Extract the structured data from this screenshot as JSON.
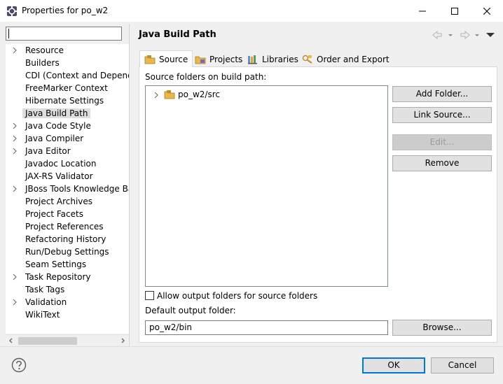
{
  "window": {
    "title": "Properties for po_w2",
    "icons": {
      "app": "eclipse-properties-icon",
      "minimize": "minimize-icon",
      "maximize": "maximize-icon",
      "close": "close-icon"
    }
  },
  "filter": {
    "value": "",
    "placeholder": ""
  },
  "tree": {
    "items": [
      {
        "label": "Resource",
        "expandable": true,
        "selected": false
      },
      {
        "label": "Builders",
        "expandable": false,
        "selected": false
      },
      {
        "label": "CDI (Context and Dependen",
        "expandable": false,
        "selected": false
      },
      {
        "label": "FreeMarker Context",
        "expandable": false,
        "selected": false
      },
      {
        "label": "Hibernate Settings",
        "expandable": false,
        "selected": false
      },
      {
        "label": "Java Build Path",
        "expandable": false,
        "selected": true
      },
      {
        "label": "Java Code Style",
        "expandable": true,
        "selected": false
      },
      {
        "label": "Java Compiler",
        "expandable": true,
        "selected": false
      },
      {
        "label": "Java Editor",
        "expandable": true,
        "selected": false
      },
      {
        "label": "Javadoc Location",
        "expandable": false,
        "selected": false
      },
      {
        "label": "JAX-RS Validator",
        "expandable": false,
        "selected": false
      },
      {
        "label": "JBoss Tools Knowledge Bas",
        "expandable": true,
        "selected": false
      },
      {
        "label": "Project Archives",
        "expandable": false,
        "selected": false
      },
      {
        "label": "Project Facets",
        "expandable": false,
        "selected": false
      },
      {
        "label": "Project References",
        "expandable": false,
        "selected": false
      },
      {
        "label": "Refactoring History",
        "expandable": false,
        "selected": false
      },
      {
        "label": "Run/Debug Settings",
        "expandable": false,
        "selected": false
      },
      {
        "label": "Seam Settings",
        "expandable": false,
        "selected": false
      },
      {
        "label": "Task Repository",
        "expandable": true,
        "selected": false
      },
      {
        "label": "Task Tags",
        "expandable": false,
        "selected": false
      },
      {
        "label": "Validation",
        "expandable": true,
        "selected": false
      },
      {
        "label": "WikiText",
        "expandable": false,
        "selected": false
      }
    ]
  },
  "page": {
    "title": "Java Build Path",
    "nav_icons": [
      "back-arrow-icon",
      "back-menu-icon",
      "forward-arrow-icon",
      "forward-menu-icon",
      "view-menu-icon"
    ]
  },
  "tabs": [
    {
      "label": "Source",
      "icon": "source-folder-icon",
      "active": true
    },
    {
      "label": "Projects",
      "icon": "projects-icon",
      "active": false
    },
    {
      "label": "Libraries",
      "icon": "libraries-icon",
      "active": false
    },
    {
      "label": "Order and Export",
      "icon": "order-export-icon",
      "active": false
    }
  ],
  "source": {
    "heading": "Source folders on build path:",
    "folders": [
      {
        "label": "po_w2/src",
        "icon": "package-folder-icon"
      }
    ],
    "buttons": {
      "add_folder": "Add Folder...",
      "link_source": "Link Source...",
      "edit": "Edit...",
      "remove": "Remove"
    },
    "allow_output_label": "Allow output folders for source folders",
    "allow_output_checked": false,
    "default_output_label": "Default output folder:",
    "default_output_value": "po_w2/bin",
    "browse_label": "Browse..."
  },
  "dialog": {
    "ok_label": "OK",
    "cancel_label": "Cancel",
    "help_icon": "help-icon"
  },
  "colors": {
    "accent": "#0078d7",
    "selection": "#dedede",
    "folder": "#e8b84b"
  }
}
